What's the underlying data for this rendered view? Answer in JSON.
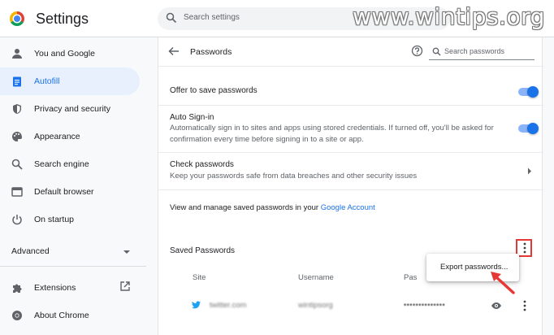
{
  "header": {
    "app_title": "Settings",
    "search_placeholder": "Search settings",
    "watermark": "www.wintips.org"
  },
  "sidebar": {
    "items": [
      {
        "label": "You and Google",
        "icon": "person-icon"
      },
      {
        "label": "Autofill",
        "icon": "clipboard-icon",
        "active": true
      },
      {
        "label": "Privacy and security",
        "icon": "shield-icon"
      },
      {
        "label": "Appearance",
        "icon": "palette-icon"
      },
      {
        "label": "Search engine",
        "icon": "search-icon"
      },
      {
        "label": "Default browser",
        "icon": "browser-icon"
      },
      {
        "label": "On startup",
        "icon": "power-icon"
      }
    ],
    "advanced_label": "Advanced",
    "extensions_label": "Extensions",
    "about_label": "About Chrome"
  },
  "passwords": {
    "title": "Passwords",
    "search_placeholder": "Search passwords",
    "offer_to_save": {
      "label": "Offer to save passwords",
      "enabled": true
    },
    "auto_signin": {
      "label": "Auto Sign-in",
      "description_line1": "Automatically sign in to sites and apps using stored credentials. If turned off, you'll be asked for",
      "description_line2": "confirmation every time before signing in to a site or app.",
      "enabled": true
    },
    "check_passwords": {
      "label": "Check passwords",
      "description": "Keep your passwords safe from data breaches and other security issues"
    },
    "manage_text": "View and manage saved passwords in your ",
    "manage_link": "Google Account",
    "saved_passwords_label": "Saved Passwords",
    "menu_item": "Export passwords...",
    "columns": {
      "site": "Site",
      "username": "Username",
      "password": "Pas"
    },
    "entry": {
      "site": "twitter.com",
      "username": "wintipsorg",
      "password_mask": "••••••••••••••"
    }
  },
  "colors": {
    "accent": "#1a73e8",
    "active_bg": "#e8f0fe",
    "highlight_red": "#e53935"
  }
}
